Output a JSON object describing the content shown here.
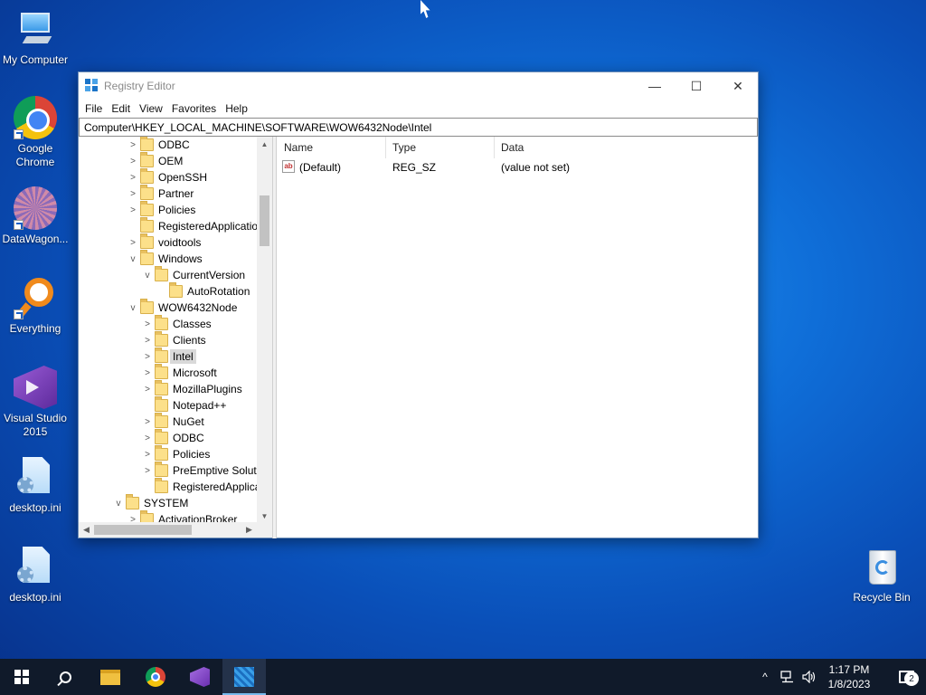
{
  "desktop": {
    "icons": [
      {
        "label": "My Computer",
        "icon": "computer-icon"
      },
      {
        "label": "Google Chrome",
        "icon": "chrome-icon"
      },
      {
        "label": "DataWagon...",
        "icon": "datawagon-icon"
      },
      {
        "label": "Everything",
        "icon": "everything-icon"
      },
      {
        "label": "Visual Studio 2015",
        "icon": "visual-studio-icon"
      },
      {
        "label": "desktop.ini",
        "icon": "ini-file-icon"
      },
      {
        "label": "desktop.ini",
        "icon": "ini-file-icon"
      },
      {
        "label": "Recycle Bin",
        "icon": "recycle-bin-icon"
      }
    ]
  },
  "window": {
    "title": "Registry Editor",
    "controls": {
      "minimize": "—",
      "maximize": "☐",
      "close": "✕"
    },
    "menu": [
      "File",
      "Edit",
      "View",
      "Favorites",
      "Help"
    ],
    "address": "Computer\\HKEY_LOCAL_MACHINE\\SOFTWARE\\WOW6432Node\\Intel",
    "tree": [
      {
        "label": "ODBC",
        "chev": ">"
      },
      {
        "label": "OEM",
        "chev": ">"
      },
      {
        "label": "OpenSSH",
        "chev": ">"
      },
      {
        "label": "Partner",
        "chev": ">"
      },
      {
        "label": "Policies",
        "chev": ">"
      },
      {
        "label": "RegisteredApplications",
        "chev": ""
      },
      {
        "label": "voidtools",
        "chev": ">"
      },
      {
        "label": "Windows",
        "chev": "v"
      },
      {
        "label": "CurrentVersion",
        "chev": "v"
      },
      {
        "label": "AutoRotation",
        "chev": ""
      },
      {
        "label": "WOW6432Node",
        "chev": "v"
      },
      {
        "label": "Classes",
        "chev": ">"
      },
      {
        "label": "Clients",
        "chev": ">"
      },
      {
        "label": "Intel",
        "chev": ">"
      },
      {
        "label": "Microsoft",
        "chev": ">"
      },
      {
        "label": "MozillaPlugins",
        "chev": ">"
      },
      {
        "label": "Notepad++",
        "chev": ""
      },
      {
        "label": "NuGet",
        "chev": ">"
      },
      {
        "label": "ODBC",
        "chev": ">"
      },
      {
        "label": "Policies",
        "chev": ">"
      },
      {
        "label": "PreEmptive Solutions",
        "chev": ">"
      },
      {
        "label": "RegisteredApplications",
        "chev": ""
      },
      {
        "label": "SYSTEM",
        "chev": "v"
      },
      {
        "label": "ActivationBroker",
        "chev": ">"
      }
    ],
    "list": {
      "columns": [
        "Name",
        "Type",
        "Data"
      ],
      "rows": [
        {
          "name": "(Default)",
          "type": "REG_SZ",
          "data": "(value not set)"
        }
      ]
    }
  },
  "taskbar": {
    "pinned": [
      "start-icon",
      "search-icon",
      "file-explorer-icon",
      "chrome-icon",
      "visual-studio-icon",
      "registry-editor-icon"
    ],
    "tray": {
      "chevron": "^",
      "network": "network-icon",
      "volume": "volume-icon"
    },
    "time": "1:17 PM",
    "date": "1/8/2023",
    "notification_count": "2"
  }
}
